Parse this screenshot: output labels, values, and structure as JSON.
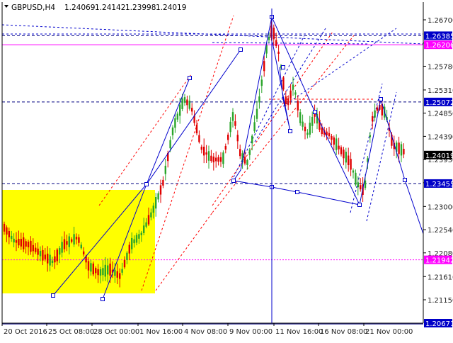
{
  "chart_data": {
    "type": "candlestick",
    "header": {
      "symbol": "GBPUSD,H4",
      "open": "1.24069",
      "high": "1.24142",
      "low": "1.23998",
      "close": "1.24019"
    },
    "y_axis": {
      "range": [
        1.20671,
        1.268
      ],
      "tick_labels": [
        "1.26700",
        "1.26240",
        "1.25780",
        "1.25310",
        "1.24850",
        "1.24390",
        "1.23930",
        "1.23470",
        "1.23000",
        "1.22540",
        "1.22080",
        "1.21610",
        "1.21150"
      ]
    },
    "x_axis": {
      "tick_labels": [
        "20 Oct 2016",
        "25 Oct 08:00",
        "28 Oct 00:00",
        "1 Nov 16:00",
        "4 Nov 08:00",
        "9 Nov 00:00",
        "11 Nov 16:00",
        "16 Nov 08:00",
        "21 Nov 00:00"
      ]
    },
    "price_badges": [
      {
        "label": "1.26385",
        "bg": "#0000c8"
      },
      {
        "label": "1.26206",
        "bg": "#ff00ff"
      },
      {
        "label": "1.25072",
        "bg": "#0000c8"
      },
      {
        "label": "1.24019",
        "bg": "#000000"
      },
      {
        "label": "1.23455",
        "bg": "#0000c8"
      },
      {
        "label": "1.21942",
        "bg": "#ff00ff"
      },
      {
        "label": "1.20671",
        "bg": "#0000c8"
      }
    ],
    "horizontal_levels": [
      {
        "price": 1.26385,
        "style": "dashed",
        "color": "#000080"
      },
      {
        "price": 1.26206,
        "style": "solid",
        "color": "#ff00ff"
      },
      {
        "price": 1.25072,
        "style": "dashed",
        "color": "#000080"
      },
      {
        "price": 1.23455,
        "style": "dashed",
        "color": "#000080"
      },
      {
        "price": 1.21942,
        "style": "dotted",
        "color": "#ff00ff"
      },
      {
        "price": 1.20671,
        "style": "solid",
        "color": "#000080"
      }
    ],
    "colors": {
      "bull": "#2aa52a",
      "bear": "#e00000",
      "zone_fill": "#ffff00",
      "trend": "#0000cc",
      "channel": "#ff0000",
      "axis_text": "#222222"
    }
  }
}
